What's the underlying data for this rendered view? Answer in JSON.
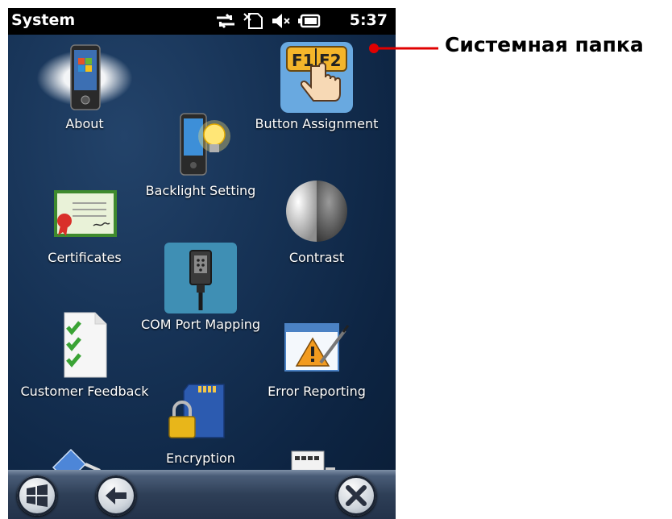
{
  "status_bar": {
    "title": "System",
    "time": "5:37"
  },
  "annotation": {
    "label": "Системная папка",
    "color": "#e00000"
  },
  "items": [
    {
      "label": "About",
      "icon": "phone-icon"
    },
    {
      "label": "Button Assignment",
      "icon": "f1-f2-hand-icon"
    },
    {
      "label": "Backlight Setting",
      "icon": "backlight-bulb-icon"
    },
    {
      "label": "Certificates",
      "icon": "certificate-icon"
    },
    {
      "label": "Contrast",
      "icon": "contrast-circle-icon"
    },
    {
      "label": "COM Port Mapping",
      "icon": "serial-port-icon"
    },
    {
      "label": "Customer Feedback",
      "icon": "checklist-icon"
    },
    {
      "label": "Error Reporting",
      "icon": "warning-window-icon"
    },
    {
      "label": "Encryption",
      "icon": "sd-card-lock-icon"
    }
  ],
  "softkeys": {
    "start": "windows-start-icon",
    "back": "back-arrow-icon",
    "close": "close-icon"
  }
}
